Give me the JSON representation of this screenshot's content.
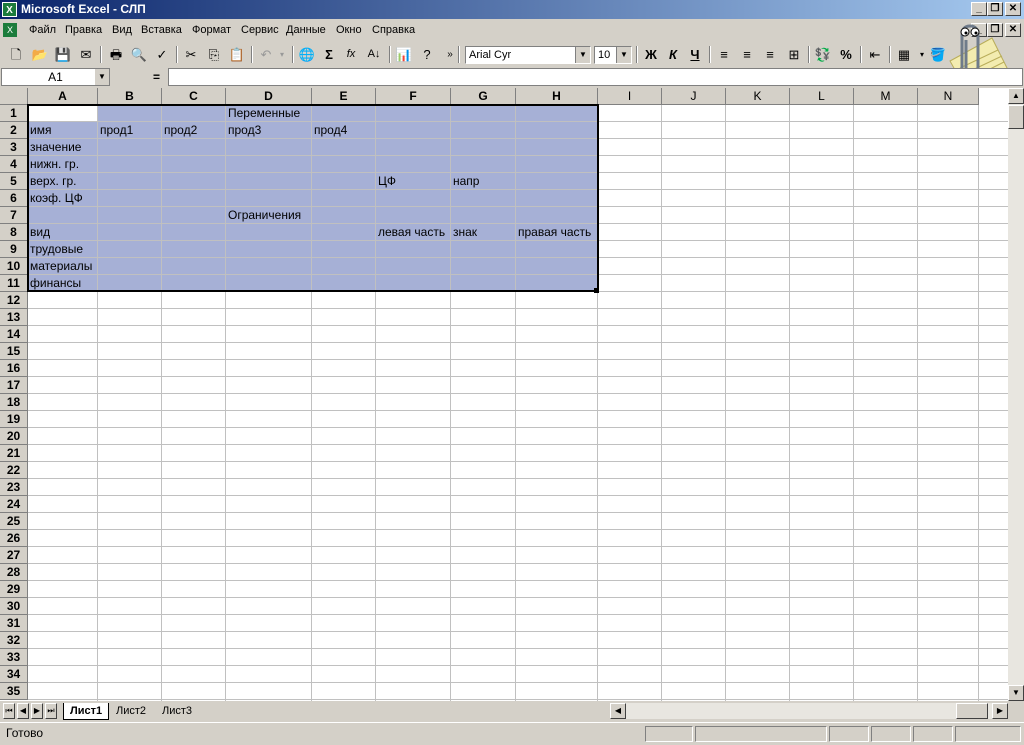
{
  "window": {
    "title": "Microsoft Excel - СЛП",
    "app_icon": "excel-icon"
  },
  "menu": [
    "Файл",
    "Правка",
    "Вид",
    "Вставка",
    "Формат",
    "Сервис",
    "Данные",
    "Окно",
    "Справка"
  ],
  "toolbar": {
    "font": "Arial Cyr",
    "size": "10",
    "bold": "Ж",
    "italic": "К",
    "underline": "Ч",
    "sum": "Σ",
    "fx": "fx",
    "percent": "%"
  },
  "formula": {
    "name_box": "A1",
    "equals": "=",
    "value": ""
  },
  "grid": {
    "columns": [
      "A",
      "B",
      "C",
      "D",
      "E",
      "F",
      "G",
      "H",
      "I",
      "J",
      "K",
      "L",
      "M",
      "N"
    ],
    "rows": [
      "1",
      "2",
      "3",
      "4",
      "5",
      "6",
      "7",
      "8",
      "9",
      "10",
      "11",
      "12",
      "13",
      "14",
      "15",
      "16",
      "17",
      "18",
      "19",
      "20",
      "21",
      "22",
      "23",
      "24",
      "25",
      "26",
      "27",
      "28",
      "29",
      "30",
      "31",
      "32",
      "33",
      "34",
      "35"
    ],
    "cells": {
      "D1": "Переменные",
      "A2": "имя",
      "B2": "прод1",
      "C2": "прод2",
      "D2": "прод3",
      "E2": "прод4",
      "A3": "значение",
      "A4": "нижн. гр.",
      "A5": "верх. гр.",
      "F5": "ЦФ",
      "G5": "напр",
      "A6": "коэф. ЦФ",
      "D7": "Ограничения",
      "A8": "вид",
      "F8": "левая часть",
      "G8": "знак",
      "H8": "правая часть",
      "A9": "трудовые",
      "A10": "материалы",
      "A11": "финансы"
    }
  },
  "sheets": [
    "Лист1",
    "Лист2",
    "Лист3"
  ],
  "status": {
    "text": "Готово"
  },
  "colors": {
    "selection": "#a6b0d6",
    "title_start": "#0a246a",
    "title_end": "#a6caf0"
  }
}
